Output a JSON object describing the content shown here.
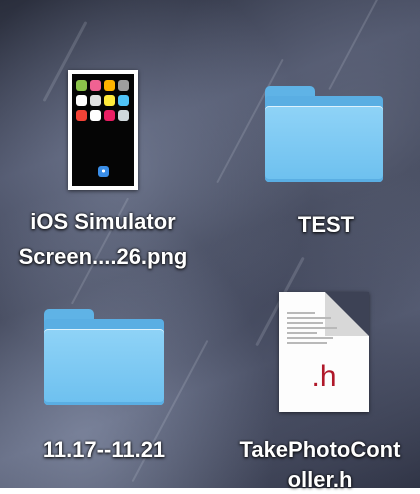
{
  "desktop": {
    "items": [
      {
        "label_line1": "iOS Simulator",
        "label_line2": "Screen....26.png",
        "icon": "image-file-thumbnail-icon"
      },
      {
        "label": "TEST",
        "icon": "folder-icon"
      },
      {
        "label": "11.17--11.21",
        "icon": "folder-icon"
      },
      {
        "label_line1": "TakePhotoCont",
        "label_line2": "oller.h",
        "icon": "header-file-icon"
      }
    ],
    "header_file_ext": ".h"
  }
}
